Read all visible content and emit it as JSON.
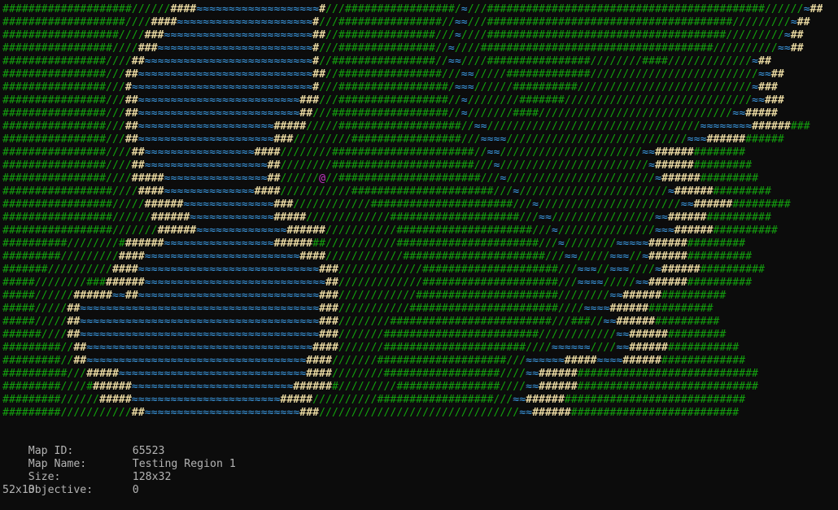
{
  "legend": {
    "wall": "#",
    "floor": "/",
    "water": "≈",
    "edge": "#",
    "player": "@"
  },
  "colors": {
    "background": "#0c0c0c",
    "wall": "#13a10e",
    "edge": "#e8d8a0",
    "floor": "#13a10e",
    "water": "#3a96dd",
    "player": "#c738c7",
    "info_text": "#b4b4b4"
  },
  "map_rows": [
    "####################//////####≈≈≈≈≈≈≈≈≈≈≈≈≈≈≈≈≈≈≈#///#################/≈///###########################################//////≈##",
    "###################////####≈≈≈≈≈≈≈≈≈≈≈≈≈≈≈≈≈≈≈≈≈#///################//≈≈///######################################/////////≈##",
    "##################////###≈≈≈≈≈≈≈≈≈≈≈≈≈≈≈≈≈≈≈≈≈≈≈##//###############///≈////#####################################/////////≈##",
    "#################////###≈≈≈≈≈≈≈≈≈≈≈≈≈≈≈≈≈≈≈≈≈≈≈≈#///###############//≈////####################################//////////≈≈##",
    "################////##≈≈≈≈≈≈≈≈≈≈≈≈≈≈≈≈≈≈≈≈≈≈≈≈≈≈#//################//≈≈////################////////####/////////////≈##",
    "################///##≈≈≈≈≈≈≈≈≈≈≈≈≈≈≈≈≈≈≈≈≈≈≈≈≈≈≈##//################///≈≈/////#############//////////////////////////≈≈##",
    "################///#≈≈≈≈≈≈≈≈≈≈≈≈≈≈≈≈≈≈≈≈≈≈≈≈≈≈≈≈#///#################/≈≈≈//////##########///////////////////////////≈###",
    "################///##≈≈≈≈≈≈≈≈≈≈≈≈≈≈≈≈≈≈≈≈≈≈≈≈≈###///#################//≈////////#######/////////////////////////////≈≈###",
    "################///##≈≈≈≈≈≈≈≈≈≈≈≈≈≈≈≈≈≈≈≈≈≈≈≈≈##///##################//≈///////####//////////////////////////////≈≈#####",
    "################///##≈≈≈≈≈≈≈≈≈≈≈≈≈≈≈≈≈≈≈≈≈#####/////###################//≈≈/////////////////////////////////≈≈≈≈≈≈≈≈#########",
    "################///##≈≈≈≈≈≈≈≈≈≈≈≈≈≈≈≈≈≈≈≈≈###/////////#################///≈≈≈≈////////////////////////////≈≈≈############",
    "################////##≈≈≈≈≈≈≈≈≈≈≈≈≈≈≈≈≈####////////######################//≈≈//////////////////////≈≈##############",
    "################////##≈≈≈≈≈≈≈≈≈≈≈≈≈≈≈≈≈≈≈##////////######################///≈///////////////////////≈###############",
    "################////#####≈≈≈≈≈≈≈≈≈≈≈≈≈≈≈≈##//////@//######################///≈///////////////////////≈###############",
    "#################////####≈≈≈≈≈≈≈≈≈≈≈≈≈≈####///////////######################///≈///////////////////////≈###############",
    "#################/////######≈≈≈≈≈≈≈≈≈≈≈≈≈≈###////////////######################///≈//////////////////////≈≈###############",
    "#################//////######≈≈≈≈≈≈≈≈≈≈≈≈≈#####/////////////####################///≈≈////////////////≈≈################",
    "#################///////######≈≈≈≈≈≈≈≈≈≈≈≈≈≈######///////////#####################///≈///////////////≈≈≈################",
    "##########////////#######≈≈≈≈≈≈≈≈≈≈≈≈≈≈≈≈≈########///////////######################///≈////////≈≈≈≈≈###############",
    "#########/////////####≈≈≈≈≈≈≈≈≈≈≈≈≈≈≈≈≈≈≈≈≈≈≈≈####////////////######################///≈≈/////≈≈≈//≈################",
    "#######//////////####≈≈≈≈≈≈≈≈≈≈≈≈≈≈≈≈≈≈≈≈≈≈≈≈≈≈≈≈###/////////////#####################///≈≈≈//≈≈≈////≈################",
    "#####////////#########≈≈≈≈≈≈≈≈≈≈≈≈≈≈≈≈≈≈≈≈≈≈≈≈≈≈≈≈##/////////////#####################///≈≈≈≈/////≈≈################",
    "#####//////######≈≈##≈≈≈≈≈≈≈≈≈≈≈≈≈≈≈≈≈≈≈≈≈≈≈≈≈≈≈≈###////////////######################////////≈≈################",
    "#####/////##≈≈≈≈≈≈≈≈≈≈≈≈≈≈≈≈≈≈≈≈≈≈≈≈≈≈≈≈≈≈≈≈≈≈≈≈≈###///////////#######################////≈≈≈≈################",
    "#####/////##≈≈≈≈≈≈≈≈≈≈≈≈≈≈≈≈≈≈≈≈≈≈≈≈≈≈≈≈≈≈≈≈≈≈≈≈≈###////////#########################///###//≈≈################",
    "######////##≈≈≈≈≈≈≈≈≈≈≈≈≈≈≈≈≈≈≈≈≈≈≈≈≈≈≈≈≈≈≈≈≈≈≈≈≈###///////########################////////////≈≈###############",
    "#########//##≈≈≈≈≈≈≈≈≈≈≈≈≈≈≈≈≈≈≈≈≈≈≈≈≈≈≈≈≈≈≈≈≈≈≈####///////######################////≈≈≈≈≈≈////≈≈#################",
    "#########//##≈≈≈≈≈≈≈≈≈≈≈≈≈≈≈≈≈≈≈≈≈≈≈≈≈≈≈≈≈≈≈≈≈≈####///////####################///≈≈≈≈≈≈#####≈≈≈≈###################",
    "##########///#####≈≈≈≈≈≈≈≈≈≈≈≈≈≈≈≈≈≈≈≈≈≈≈≈≈≈≈≈≈####////////##################////≈≈##################################",
    "#########////#######≈≈≈≈≈≈≈≈≈≈≈≈≈≈≈≈≈≈≈≈≈≈≈≈≈#######/////////################////≈≈##################################",
    "#########//////#####≈≈≈≈≈≈≈≈≈≈≈≈≈≈≈≈≈≈≈≈≈≈≈#####//////////##################///≈≈##################################",
    "#########///////////##≈≈≈≈≈≈≈≈≈≈≈≈≈≈≈≈≈≈≈≈≈≈≈≈###///////////////////////////////≈≈################################"
  ],
  "info": {
    "map_id_label": "Map ID:",
    "map_id_value": "65523",
    "map_name_label": "Map Name:",
    "map_name_value": "Testing Region 1",
    "size_label": "Size:",
    "size_value": "128x32",
    "objective_label": "Objective:",
    "objective_value": "0",
    "cursor_text": "52x13"
  }
}
